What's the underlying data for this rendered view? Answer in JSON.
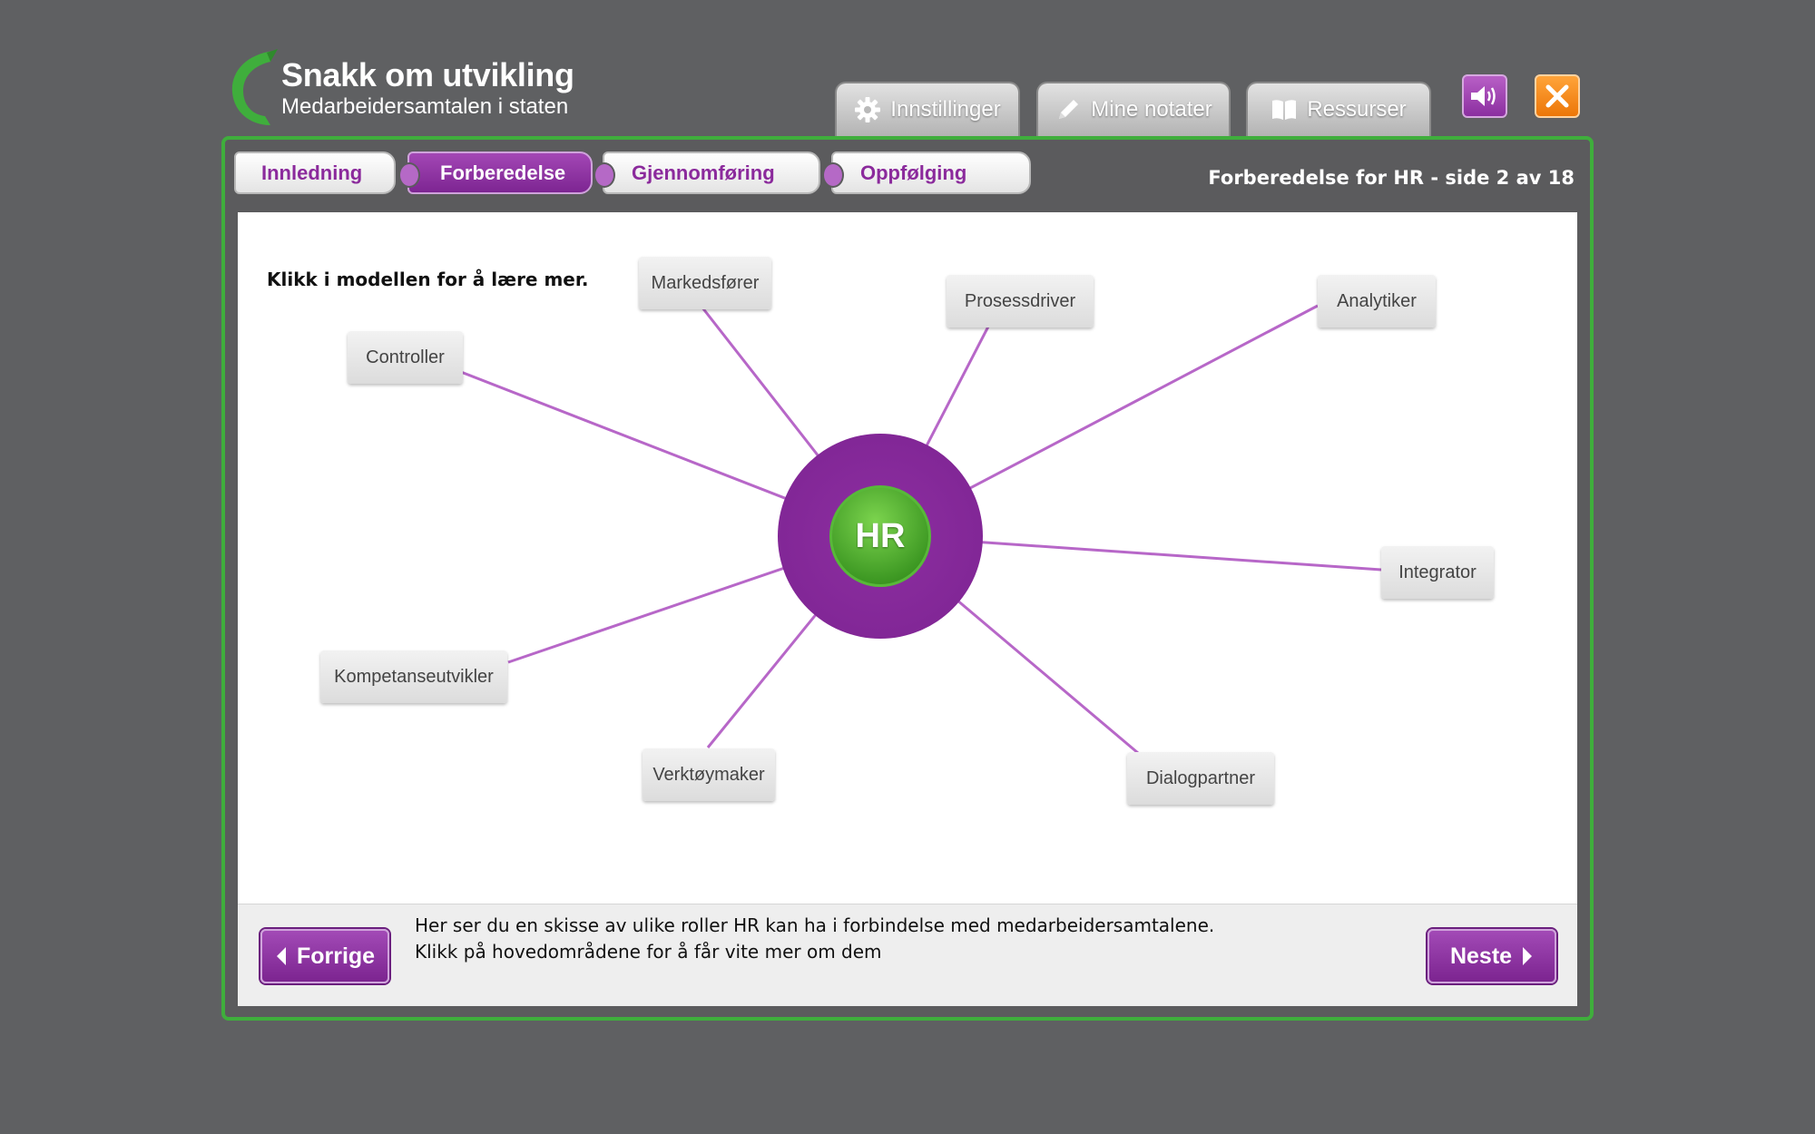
{
  "app": {
    "title": "Snakk om utvikling",
    "subtitle": "Medarbeidersamtalen i staten"
  },
  "toolbar": {
    "settings_label": "Innstillinger",
    "notes_label": "Mine notater",
    "resources_label": "Ressurser"
  },
  "colors": {
    "brand_green": "#3fae3c",
    "accent_purple": "#8b2fa0",
    "close_orange": "#f08c1e",
    "background": "#5f6062"
  },
  "tabs": [
    {
      "label": "Innledning",
      "active": false
    },
    {
      "label": "Forberedelse",
      "active": true
    },
    {
      "label": "Gjennomføring",
      "active": false
    },
    {
      "label": "Oppfølging",
      "active": false
    }
  ],
  "page_info": "Forberedelse for HR - side 2 av 18",
  "main": {
    "instruction": "Klikk i modellen for å lære mer.",
    "hub_label": "HR",
    "roles": [
      "Markedsfører",
      "Prosessdriver",
      "Analytiker",
      "Controller",
      "Integrator",
      "Kompetanseutvikler",
      "Verktøymaker",
      "Dialogpartner"
    ]
  },
  "footer": {
    "description_line1": "Her ser du en skisse av ulike roller HR kan ha i forbindelse med medarbeidersamtalene.",
    "description_line2": "Klikk på hovedområdene for å får vite mer om dem",
    "prev_label": "Forrige",
    "next_label": "Neste"
  },
  "icons": {
    "settings": "gear-icon",
    "notes": "pencil-icon",
    "resources": "book-icon",
    "sound": "speaker-icon",
    "close": "close-icon",
    "prev": "arrow-left-icon",
    "next": "arrow-right-icon"
  }
}
